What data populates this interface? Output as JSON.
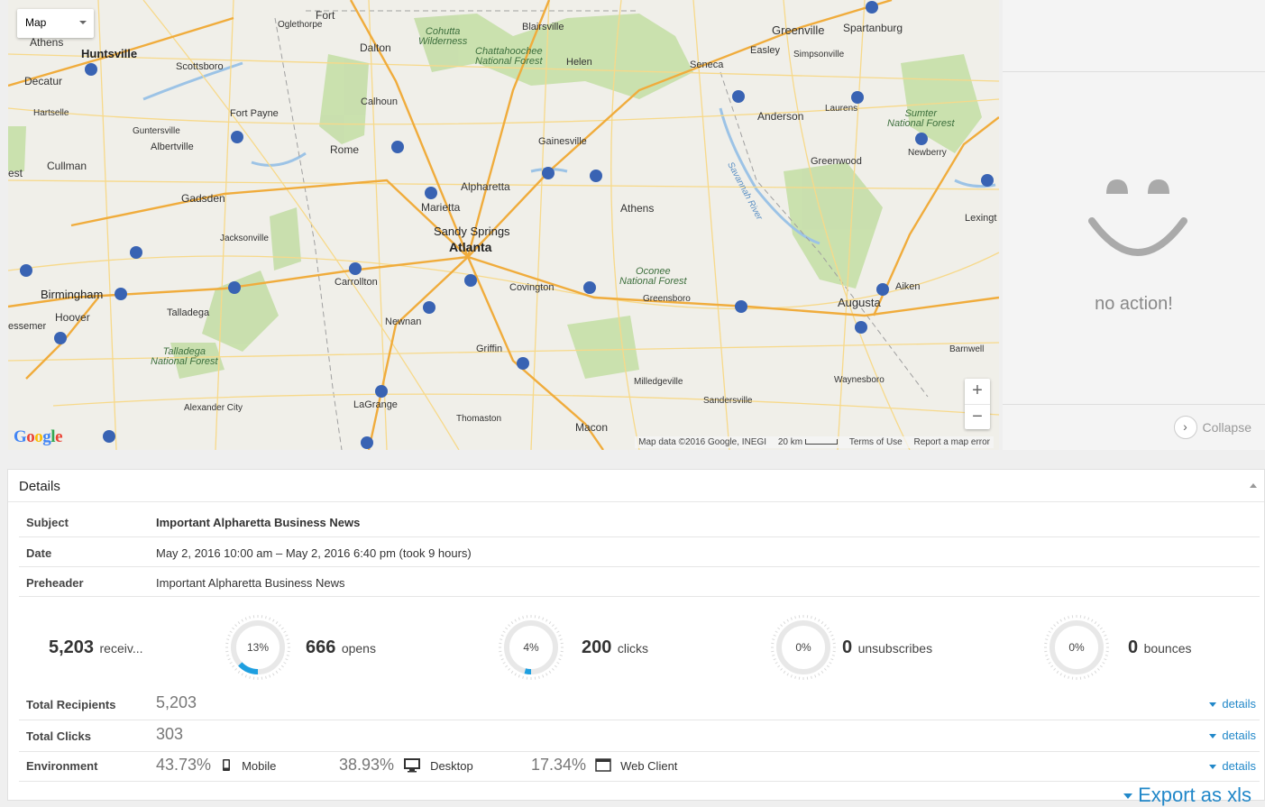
{
  "map": {
    "type_selector": "Map",
    "zoom_in": "+",
    "zoom_out": "−",
    "logo": "Google",
    "attribution": "Map data ©2016 Google, INEGI",
    "scale": "20 km",
    "terms": "Terms of Use",
    "report": "Report a map error",
    "labels": {
      "athens_al": "Athens",
      "huntsville": "Huntsville",
      "scottsboro": "Scottsboro",
      "decatur": "Decatur",
      "hartselle": "Hartselle",
      "guntersville": "Guntersville",
      "albertville": "Albertville",
      "cullman": "Cullman",
      "gadsden": "Gadsden",
      "jacksonville": "Jacksonville",
      "birmingham": "Birmingham",
      "hoover": "Hoover",
      "bessemer": "essemer",
      "talladega": "Talladega",
      "talladega_nf": "Talladega\nNational Forest",
      "fort": "Fort",
      "oglethorpe": "Oglethorpe",
      "dalton": "Dalton",
      "fort_payne": "Fort Payne",
      "calhoun": "Calhoun",
      "rome": "Rome",
      "cohutta": "Cohutta\nWilderness",
      "chattahoochee": "Chattahoochee\nNational Forest",
      "blairsville": "Blairsville",
      "helen": "Helen",
      "gainesville": "Gainesville",
      "alpharetta": "Alpharetta",
      "marietta": "Marietta",
      "sandy_springs": "Sandy Springs",
      "atlanta": "Atlanta",
      "carrollton": "Carrollton",
      "newnan": "Newnan",
      "lagrange": "LaGrange",
      "alexander_city": "Alexander City",
      "griffin": "Griffin",
      "thomaston": "Thomaston",
      "macon": "Macon",
      "covington": "Covington",
      "athens_ga": "Athens",
      "oconee_nf": "Oconee\nNational Forest",
      "greensboro": "Greensboro",
      "milledgeville": "Milledgeville",
      "sandersville": "Sandersville",
      "augusta": "Augusta",
      "aiken": "Aiken",
      "waynesboro": "Waynesboro",
      "barnwell": "Barnwell",
      "greenville": "Greenville",
      "spartanburg": "Spartanburg",
      "easley": "Easley",
      "simpsonville": "Simpsonville",
      "seneca": "Seneca",
      "anderson": "Anderson",
      "laurens": "Laurens",
      "sumter_nf": "Sumter\nNational Forest",
      "newberry": "Newberry",
      "greenwood": "Greenwood",
      "lexington": "Lexingt",
      "savannah_river": "Savannah River",
      "est": "est"
    }
  },
  "side": {
    "message": "no action!",
    "collapse": "Collapse"
  },
  "details": {
    "title": "Details",
    "subject_label": "Subject",
    "subject_value": "Important Alpharetta Business News",
    "date_label": "Date",
    "date_value": "May 2, 2016 10:00 am – May 2, 2016 6:40 pm (took 9 hours)",
    "preheader_label": "Preheader",
    "preheader_value": "Important Alpharetta Business News",
    "stats": {
      "received_num": "5,203",
      "received_unit": "receiv...",
      "opens_pct": "13%",
      "opens_fraction": 0.13,
      "opens_num": "666",
      "opens_unit": "opens",
      "clicks_pct": "4%",
      "clicks_fraction": 0.04,
      "clicks_num": "200",
      "clicks_unit": "clicks",
      "unsub_pct": "0%",
      "unsub_fraction": 0,
      "unsub_num": "0",
      "unsub_unit": "unsubscribes",
      "bounce_pct": "0%",
      "bounce_fraction": 0,
      "bounce_num": "0",
      "bounce_unit": "bounces"
    },
    "total_recipients_label": "Total Recipients",
    "total_recipients_value": "5,203",
    "total_clicks_label": "Total Clicks",
    "total_clicks_value": "303",
    "environment_label": "Environment",
    "env_mobile_pct": "43.73%",
    "env_mobile_label": "Mobile",
    "env_desktop_pct": "38.93%",
    "env_desktop_label": "Desktop",
    "env_web_pct": "17.34%",
    "env_web_label": "Web Client",
    "details_link": "details",
    "export": "Export as xls"
  },
  "colors": {
    "accent": "#2288c9",
    "donut_fill": "#1e9fe0",
    "donut_track": "#e8e8e8"
  }
}
